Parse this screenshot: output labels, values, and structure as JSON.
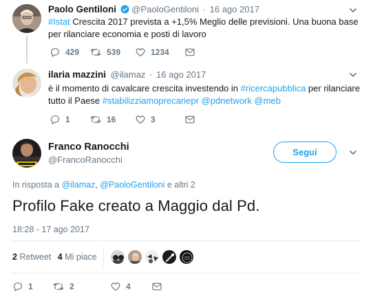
{
  "tweet1": {
    "name": "Paolo Gentiloni",
    "handle": "@PaoloGentiloni",
    "sep": "·",
    "date": "16 ago 2017",
    "hashtag": "#Istat",
    "text_a": " Crescita 2017 prevista a +1,5% Meglio delle previsioni. Una buona base",
    "text_b": "per rilanciare economia e posti di lavoro",
    "replies": "429",
    "retweets": "539",
    "likes": "1234"
  },
  "tweet2": {
    "name": "ilaria mazzini",
    "handle": "@ilamaz",
    "sep": "·",
    "date": "16 ago 2017",
    "line1_a": "è il momento di cavalcare crescita investendo in ",
    "line1_tag": "#ricercapubblica",
    "line1_b": " per rilanciare",
    "line2_a": "tutto il Paese ",
    "line2_tag1": "#stabilizziamoprecariepr",
    "line2_sp1": " ",
    "line2_tag2": "@pdnetwork",
    "line2_sp2": " ",
    "line2_tag3": "@meb",
    "replies": "1",
    "retweets": "16",
    "likes": "3"
  },
  "main": {
    "name": "Franco Ranocchi",
    "handle": "@FrancoRanocchi",
    "follow_label": "Segui",
    "reply_prefix": "In risposta a ",
    "reply_user1": "@ilamaz",
    "reply_comma": ", ",
    "reply_user2": "@PaoloGentiloni",
    "reply_suffix": " e altri 2",
    "text": "Profilo Fake creato a Maggio dal Pd.",
    "timestamp": "18:28 - 17 ago 2017",
    "retweet_count": "2",
    "retweet_label": "Retweet",
    "like_count": "4",
    "like_label": "Mi piace",
    "replies": "1",
    "retweets": "2",
    "likes": "4"
  },
  "colors": {
    "accent": "#1da1f2",
    "muted": "#657786",
    "text": "#14171a",
    "divider": "#e6ecf0"
  },
  "icons": [
    "reply-icon",
    "retweet-icon",
    "like-icon",
    "dm-icon",
    "chevron-down-icon",
    "verified-icon"
  ]
}
